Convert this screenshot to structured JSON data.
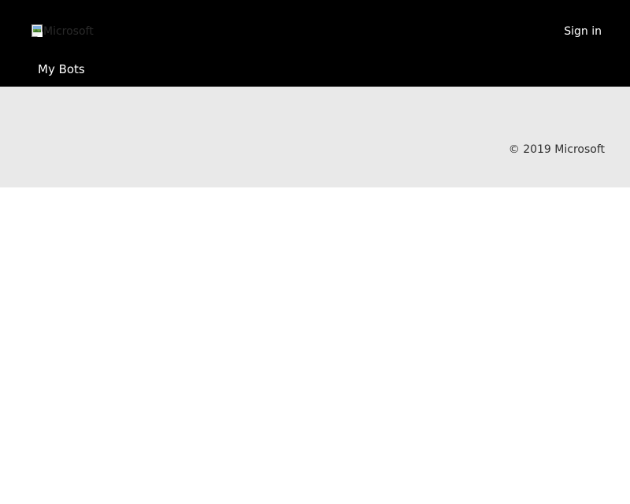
{
  "header": {
    "logo_alt": "Microsoft",
    "sign_in_label": "Sign in",
    "nav": {
      "my_bots_label": "My Bots"
    }
  },
  "footer": {
    "copyright": "© 2019 Microsoft"
  },
  "colors": {
    "header_bg": "#000000",
    "footer_bg": "#e9e9e9",
    "body_bg": "#ffffff"
  }
}
